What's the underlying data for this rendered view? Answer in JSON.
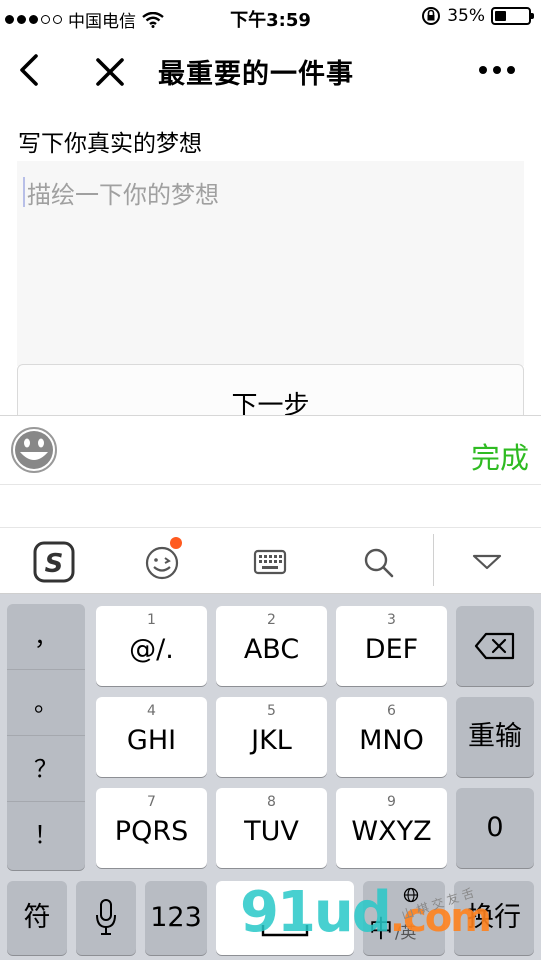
{
  "status_bar": {
    "carrier": "中国电信",
    "time": "下午3:59",
    "battery_percent": "35%",
    "battery_level": 0.35
  },
  "nav": {
    "title": "最重要的一件事",
    "back_icon": "back-chevron-icon",
    "close_icon": "close-icon",
    "more_icon": "more-dots-icon"
  },
  "form": {
    "label": "写下你真实的梦想",
    "placeholder": "描绘一下你的梦想",
    "next_button": "下一步"
  },
  "accessory": {
    "emoji_icon": "emoji-face-icon",
    "done_label": "完成",
    "done_color": "#2fbb22"
  },
  "keyboard_toolbar": {
    "icons": [
      "sogou-logo-icon",
      "emoji-smile-icon",
      "keyboard-icon",
      "search-icon",
      "collapse-triangle-icon"
    ],
    "badge_color": "#ff5a1f"
  },
  "keyboard": {
    "punctuation": [
      "，",
      "。",
      "？",
      "！"
    ],
    "keys": [
      {
        "num": "1",
        "label": "@/."
      },
      {
        "num": "2",
        "label": "ABC"
      },
      {
        "num": "3",
        "label": "DEF"
      },
      {
        "num": "4",
        "label": "GHI"
      },
      {
        "num": "5",
        "label": "JKL"
      },
      {
        "num": "6",
        "label": "MNO"
      },
      {
        "num": "7",
        "label": "PQRS"
      },
      {
        "num": "8",
        "label": "TUV"
      },
      {
        "num": "9",
        "label": "WXYZ"
      }
    ],
    "backspace_icon": "backspace-icon",
    "reenter_label": "重输",
    "zero_label": "0",
    "symbols_label": "符",
    "mic_icon": "microphone-icon",
    "numbers_label": "123",
    "lang_cn": "中",
    "lang_en": "/英",
    "globe_icon": "globe-icon",
    "enter_label": "换行"
  },
  "watermark": {
    "brand": "91ud",
    "tld": ".com",
    "sub": "山 棋 交 友 舌"
  }
}
